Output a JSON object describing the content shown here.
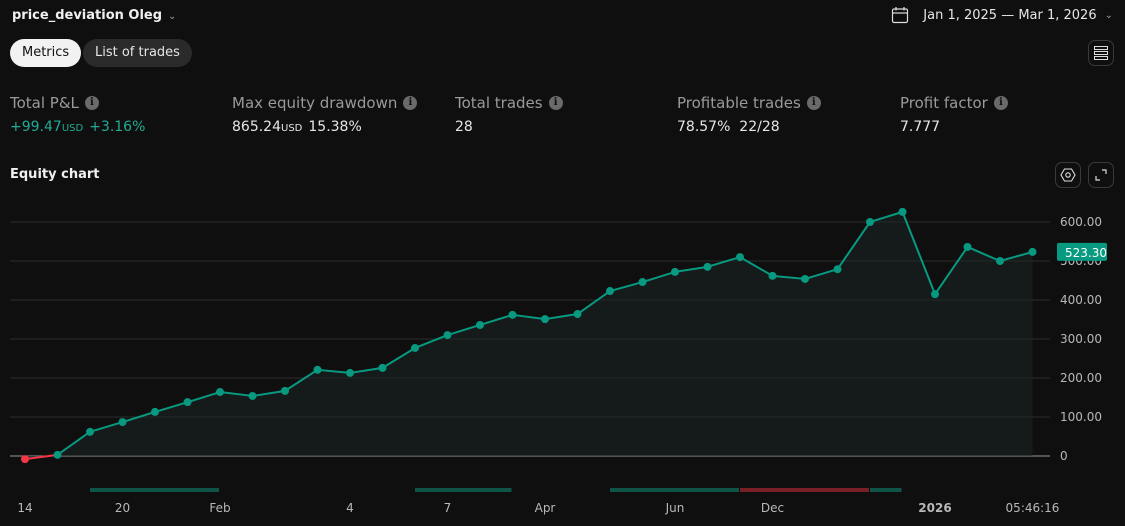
{
  "header": {
    "title": "price_deviation Oleg",
    "date_range": "Jan 1, 2025 — Mar 1, 2026"
  },
  "tabs": [
    {
      "label": "Metrics",
      "active": true
    },
    {
      "label": "List of trades",
      "active": false
    }
  ],
  "metrics": [
    {
      "label": "Total P&L",
      "value": "+99.47",
      "unit": "USD",
      "extra": "+3.16%",
      "positive": true
    },
    {
      "label": "Max equity drawdown",
      "value": "865.24",
      "unit": "USD",
      "extra": "15.38%"
    },
    {
      "label": "Total trades",
      "value": "28"
    },
    {
      "label": "Profitable trades",
      "value": "78.57%",
      "extra": "22/28"
    },
    {
      "label": "Profit factor",
      "value": "7.777"
    }
  ],
  "equity_title": "Equity chart",
  "colors": {
    "up": "#089981",
    "down": "#f23645",
    "band_up": "#0f5547",
    "band_down": "#7a1f25",
    "bg": "#0f0f0f"
  },
  "chart_data": {
    "type": "line",
    "values": [
      -8,
      3,
      62,
      87,
      113,
      138,
      164,
      154,
      167,
      221,
      213,
      226,
      277,
      310,
      336,
      362,
      351,
      364,
      423,
      446,
      472,
      485,
      510,
      462,
      454,
      479,
      600,
      626,
      415,
      536,
      500,
      523.3
    ],
    "ylim": [
      0,
      600
    ],
    "yticks": [
      "0",
      "100.00",
      "200.00",
      "300.00",
      "400.00",
      "500.00",
      "600.00"
    ],
    "ytick_values": [
      0,
      100,
      200,
      300,
      400,
      500,
      600
    ],
    "last_value_label": "523.30",
    "xticks": [
      {
        "label": "14",
        "index": 0
      },
      {
        "label": "20",
        "index": 3
      },
      {
        "label": "Feb",
        "index": 6
      },
      {
        "label": "4",
        "index": 10
      },
      {
        "label": "7",
        "index": 13
      },
      {
        "label": "Apr",
        "index": 16
      },
      {
        "label": "Jun",
        "index": 20
      },
      {
        "label": "Dec",
        "index": 23
      },
      {
        "label": "2026",
        "index": 28,
        "bold": true
      },
      {
        "label": "05:46:16",
        "index": 31
      }
    ],
    "period_bands": [
      {
        "from": 2,
        "to": 6,
        "kind": "up"
      },
      {
        "from": 12,
        "to": 15,
        "kind": "up"
      },
      {
        "from": 18,
        "to": 22,
        "kind": "up"
      },
      {
        "from": 22,
        "to": 26,
        "kind": "down"
      },
      {
        "from": 26,
        "to": 27,
        "kind": "up"
      }
    ],
    "grid": true
  }
}
